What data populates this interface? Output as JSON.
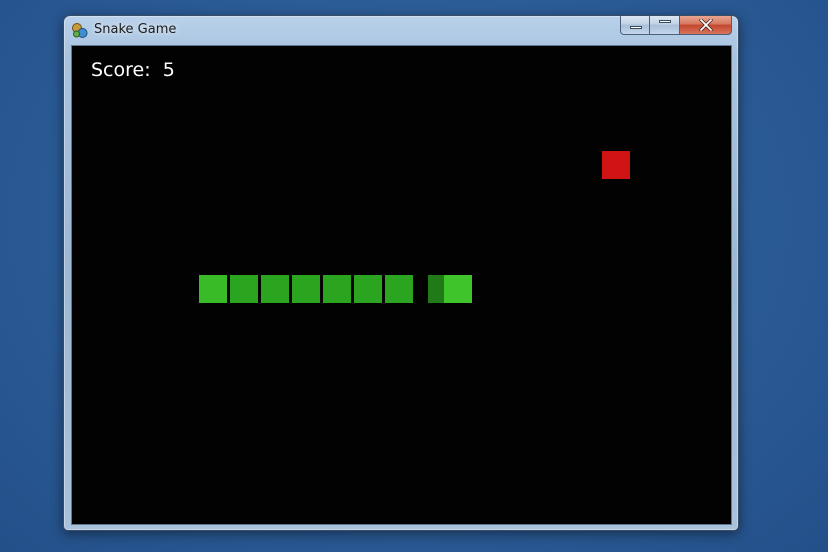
{
  "window": {
    "title": "Snake Game",
    "app_icon": "snake-game-app-icon",
    "buttons": [
      {
        "name": "minimize-button",
        "icon": "minimize-icon"
      },
      {
        "name": "maximize-button",
        "icon": "maximize-icon"
      },
      {
        "name": "close-button",
        "icon": "close-icon"
      }
    ]
  },
  "game": {
    "score_label": "Score:",
    "score_value": "5",
    "score_text": "Score:  5",
    "grid": {
      "cols": 21,
      "rows": 15
    },
    "snake": {
      "direction": "right",
      "segments": [
        {
          "col": 4,
          "row": 7,
          "part": "tail"
        },
        {
          "col": 5,
          "row": 7,
          "part": "body"
        },
        {
          "col": 6,
          "row": 7,
          "part": "body"
        },
        {
          "col": 7,
          "row": 7,
          "part": "body"
        },
        {
          "col": 8,
          "row": 7,
          "part": "body"
        },
        {
          "col": 9,
          "row": 7,
          "part": "body"
        },
        {
          "col": 10,
          "row": 7,
          "part": "body"
        },
        {
          "col": 11,
          "row": 7,
          "part": "neck"
        },
        {
          "col": 12,
          "row": 7,
          "part": "head"
        }
      ]
    },
    "food": {
      "col": 17,
      "row": 3
    },
    "colors": {
      "background": "#020202",
      "snake_head": "#3fc42b",
      "snake_body": "#2ba41f",
      "snake_tail": "#38bb27",
      "snake_neck": "#1f7a17",
      "food": "#d01414",
      "score_text": "#ffffff"
    }
  }
}
